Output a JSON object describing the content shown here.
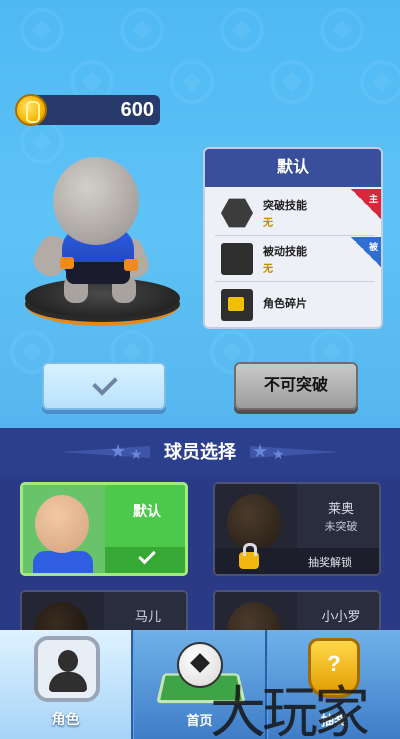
{
  "currency": {
    "coins": "600"
  },
  "character_info": {
    "title": "默认",
    "skills": [
      {
        "label": "突破技能",
        "value": "无",
        "tag": "主"
      },
      {
        "label": "被动技能",
        "value": "无",
        "tag": "被"
      },
      {
        "label": "角色碎片",
        "value": ""
      }
    ]
  },
  "actions": {
    "locked_label": "不可突破"
  },
  "player_select": {
    "title": "球员选择",
    "cards": [
      {
        "name": "默认"
      },
      {
        "name": "莱奥",
        "status": "未突破",
        "unlock_text": "抽奖解锁"
      },
      {
        "name": "马儿"
      },
      {
        "name": "小小罗"
      }
    ]
  },
  "nav": {
    "items": [
      {
        "label": "角色"
      },
      {
        "label": "首页"
      },
      {
        "label": "抽奖"
      }
    ]
  },
  "watermark": "大玩家",
  "colors": {
    "panel_header": "#3a4f9b",
    "selected_card": "#4cc94a",
    "coin": "#f5b400",
    "tag_main": "#d8263a",
    "tag_passive": "#2f6fd1"
  }
}
